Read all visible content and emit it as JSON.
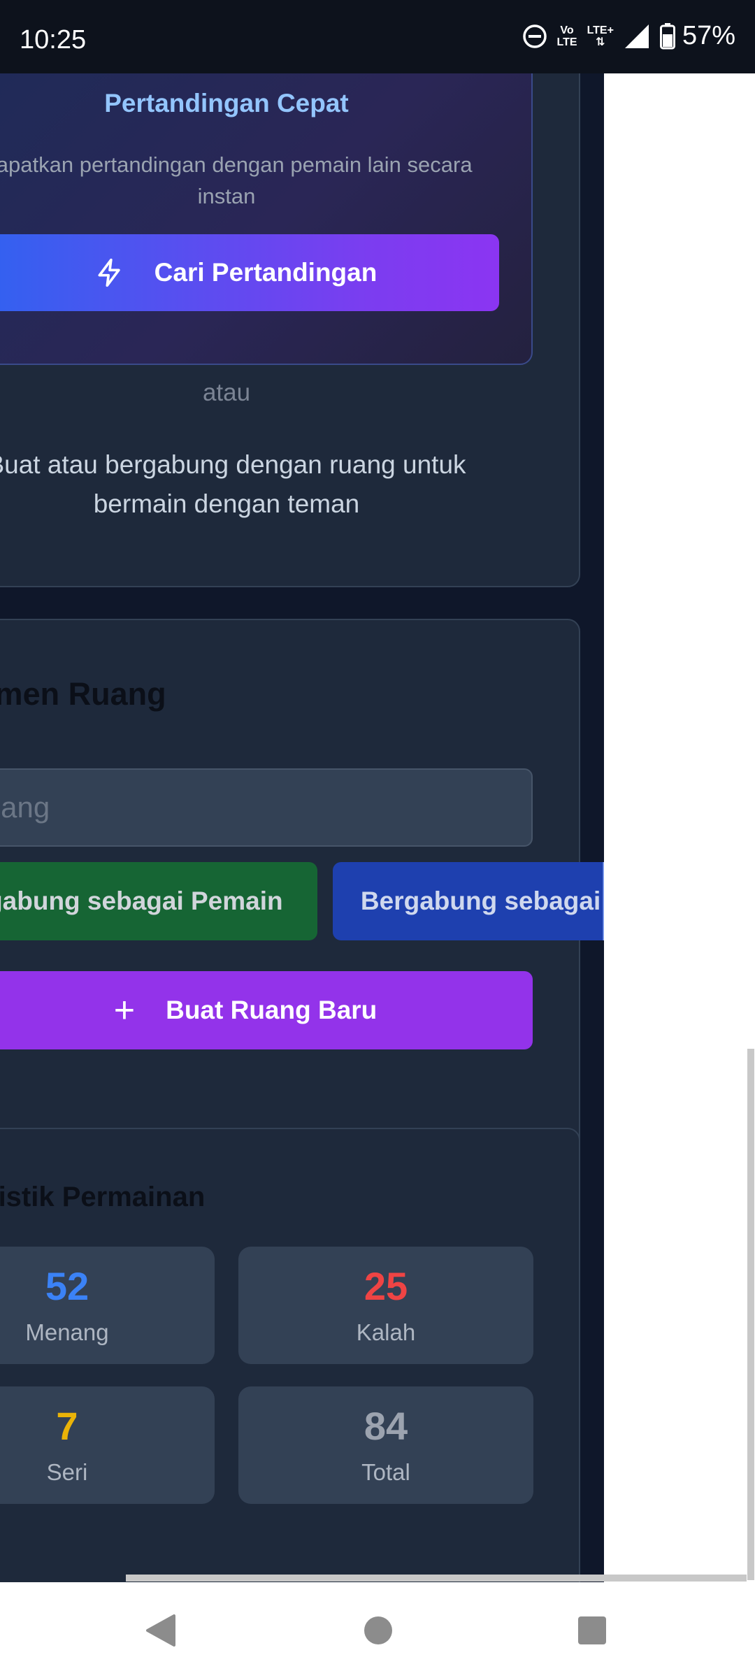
{
  "status_bar": {
    "time": "10:25",
    "net1_top": "Vo",
    "net1_bottom": "LTE",
    "net2": "LTE+",
    "battery": "57%"
  },
  "quick_match": {
    "title": "Pertandingan Cepat",
    "description": "Dapatkan pertandingan dengan pemain lain secara instan",
    "button": "Cari Pertandingan"
  },
  "divider_text": "atau",
  "join_text": "Buat atau bergabung dengan ruang untuk bermain dengan teman",
  "room_management": {
    "heading": "Manajemen Ruang",
    "code_placeholder": "Kode ruang",
    "join_player_button": "Bergabung sebagai Pemain",
    "join_spectator_button": "Bergabung sebagai Penonton",
    "create_button": "Buat Ruang Baru"
  },
  "statistics": {
    "heading": "Statistik Permainan",
    "items": [
      {
        "value": "52",
        "label": "Menang",
        "color": "#3b82f6"
      },
      {
        "value": "25",
        "label": "Kalah",
        "color": "#ef4444"
      },
      {
        "value": "7",
        "label": "Seri",
        "color": "#eab308"
      },
      {
        "value": "84",
        "label": "Total",
        "color": "#9ca3af"
      }
    ]
  },
  "colors": {
    "background": "#0f172a",
    "card": "#1e293b",
    "accent_blue": "#3b82f6",
    "accent_purple": "#9333ea",
    "player_button": "#15803d",
    "spectator_button": "#1e40af"
  }
}
